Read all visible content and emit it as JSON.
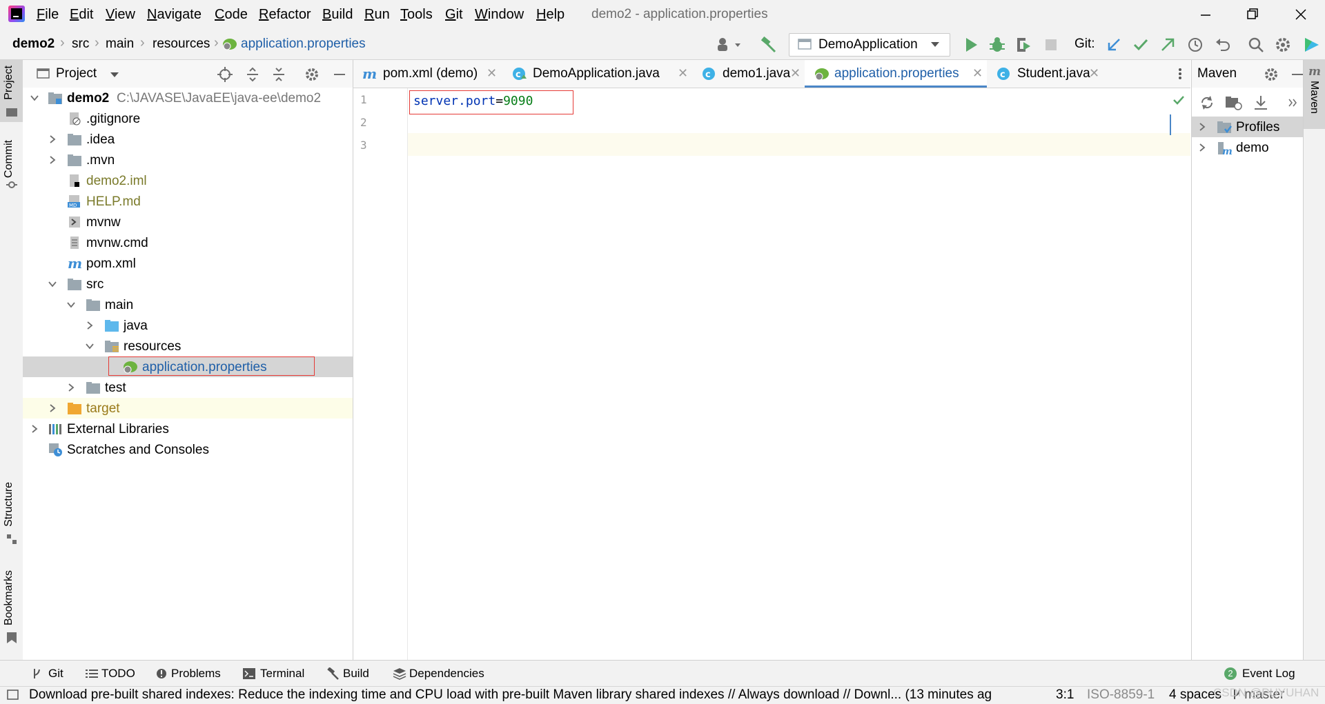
{
  "menu": {
    "items": [
      "File",
      "Edit",
      "View",
      "Navigate",
      "Code",
      "Refactor",
      "Build",
      "Run",
      "Tools",
      "Git",
      "Window",
      "Help"
    ],
    "mnemonics": [
      "F",
      "E",
      "V",
      "N",
      "C",
      "R",
      "B",
      "R",
      "T",
      "G",
      "W",
      "H"
    ],
    "rest": [
      "ile",
      "dit",
      "iew",
      "avigate",
      "ode",
      "efactor",
      "uild",
      "un",
      "ools",
      "it",
      "indow",
      "elp"
    ],
    "window_title": "demo2 - application.properties"
  },
  "breadcrumb": {
    "items": [
      "demo2",
      "src",
      "main",
      "resources",
      "application.properties"
    ]
  },
  "toolbar": {
    "run_config": "DemoApplication",
    "git_label": "Git:"
  },
  "left_stripe": {
    "project": "Project",
    "commit": "Commit",
    "structure": "Structure",
    "bookmarks": "Bookmarks"
  },
  "project_panel": {
    "title": "Project",
    "tree": [
      {
        "label": "demo2",
        "path": "C:\\JAVASE\\JavaEE\\java-ee\\demo2",
        "expanded": true
      },
      {
        "label": ".gitignore"
      },
      {
        "label": ".idea",
        "expanded": false
      },
      {
        "label": ".mvn",
        "expanded": false
      },
      {
        "label": "demo2.iml"
      },
      {
        "label": "HELP.md"
      },
      {
        "label": "mvnw"
      },
      {
        "label": "mvnw.cmd"
      },
      {
        "label": "pom.xml"
      },
      {
        "label": "src",
        "expanded": true
      },
      {
        "label": "main",
        "expanded": true
      },
      {
        "label": "java",
        "expanded": false
      },
      {
        "label": "resources",
        "expanded": true
      },
      {
        "label": "application.properties",
        "selected": true
      },
      {
        "label": "test",
        "expanded": false
      },
      {
        "label": "target",
        "expanded": false
      },
      {
        "label": "External Libraries",
        "expanded": false
      },
      {
        "label": "Scratches and Consoles"
      }
    ]
  },
  "editor": {
    "tabs": [
      {
        "label": "pom.xml (demo)",
        "icon": "maven-icon"
      },
      {
        "label": "DemoApplication.java",
        "icon": "class-icon"
      },
      {
        "label": "demo1.java",
        "icon": "class-icon"
      },
      {
        "label": "application.properties",
        "icon": "spring-leaf-icon",
        "active": true
      },
      {
        "label": "Student.java",
        "icon": "class-icon"
      }
    ],
    "line_numbers": [
      "1",
      "2",
      "3"
    ],
    "code": {
      "key": "server.port",
      "eq": "=",
      "value": "9090"
    }
  },
  "maven_panel": {
    "title": "Maven",
    "tree": [
      {
        "label": "Profiles"
      },
      {
        "label": "demo"
      }
    ],
    "stripe_label": "Maven"
  },
  "bottom_tools": [
    "Git",
    "TODO",
    "Problems",
    "Terminal",
    "Build",
    "Dependencies"
  ],
  "event_log": {
    "label": "Event Log",
    "count": "2"
  },
  "status": {
    "message": "Download pre-built shared indexes: Reduce the indexing time and CPU load with pre-built Maven library shared indexes // Always download // Downl... (13 minutes ag",
    "position": "3:1",
    "encoding": "ISO-8859-1",
    "indent": "4 spaces",
    "branch": "master",
    "watermark": "CSDN @PUYUHAN"
  },
  "colors": {
    "accent": "#4a86c7",
    "highlight_box": "#e53935",
    "selected_row": "#d5d5d5",
    "excluded_row": "#fdfde8",
    "code_key": "#0033b3",
    "code_value": "#067d17",
    "folder": "#9aa7b0",
    "target_folder": "#f0a732"
  }
}
